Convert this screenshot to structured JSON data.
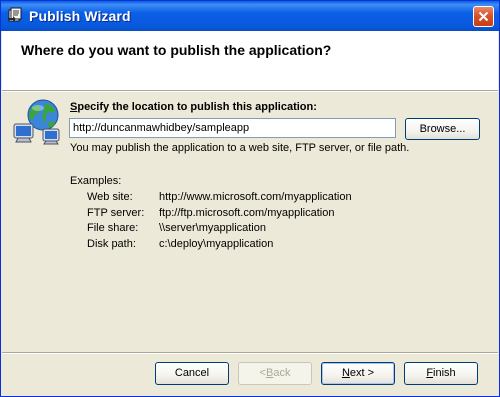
{
  "window": {
    "title": "Publish Wizard",
    "icon": "publish-wizard-icon",
    "close_icon": "close-icon"
  },
  "header": {
    "title": "Where do you want to publish the application?"
  },
  "location": {
    "icon": "globe-computers-icon",
    "label_mnemonic": "S",
    "label_rest": "pecify the location to publish this application:",
    "value": "http://duncanmawhidbey/sampleapp",
    "browse_label": "Browse...",
    "help_text": "You may publish the application to a web site, FTP server, or file path."
  },
  "examples": {
    "title": "Examples:",
    "items": [
      {
        "label": "Web site:",
        "value": "http://www.microsoft.com/myapplication"
      },
      {
        "label": "FTP server:",
        "value": "ftp://ftp.microsoft.com/myapplication"
      },
      {
        "label": "File share:",
        "value": "\\\\server\\myapplication"
      },
      {
        "label": "Disk path:",
        "value": "c:\\deploy\\myapplication"
      }
    ]
  },
  "buttons": {
    "cancel": "Cancel",
    "back_prefix": "< ",
    "back_mnemonic": "B",
    "back_rest": "ack",
    "next_mnemonic": "N",
    "next_rest": "ext >",
    "finish_mnemonic": "F",
    "finish_rest": "inish"
  },
  "colors": {
    "titlebar": "#0858dc",
    "dialog_bg": "#ece9d8",
    "header_bg": "#ffffff",
    "close_button": "#d9542b"
  }
}
